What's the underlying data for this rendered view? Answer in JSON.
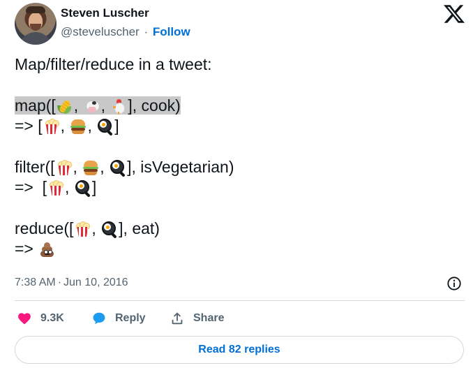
{
  "author": {
    "name": "Steven Luscher",
    "handle": "@steveluscher",
    "separator": "·",
    "follow_label": "Follow"
  },
  "tweet": {
    "intro": "Map/filter/reduce in a tweet:",
    "map": {
      "open": "map([",
      "sep1": ",",
      "sep2": ",",
      "close": "], cook)",
      "input_emojis": [
        "corn",
        "cow",
        "chicken"
      ],
      "arrow": "=> [",
      "out_sep1": ",",
      "out_sep2": ",",
      "out_close": "]",
      "output_emojis": [
        "popcorn",
        "hamburger",
        "fried-egg"
      ]
    },
    "filter": {
      "open": "filter([",
      "sep1": ",",
      "sep2": ",",
      "close": "], isVegetarian)",
      "input_emojis": [
        "popcorn",
        "hamburger",
        "fried-egg"
      ],
      "arrow": "=>  [",
      "out_sep1": ",",
      "out_close": "]",
      "output_emojis": [
        "popcorn",
        "fried-egg"
      ]
    },
    "reduce": {
      "open": "reduce([",
      "sep1": ",",
      "close": "], eat)",
      "input_emojis": [
        "popcorn",
        "fried-egg"
      ],
      "arrow": "=>",
      "output_emojis": [
        "pile-of-poo"
      ]
    }
  },
  "meta": {
    "time": "7:38 AM",
    "separator": "·",
    "date": "Jun 10, 2016"
  },
  "actions": {
    "like_count": "9.3K",
    "reply_label": "Reply",
    "share_label": "Share",
    "read_replies_label": "Read 82 replies"
  },
  "colors": {
    "text": "#0f1419",
    "secondary": "#536471",
    "link": "#006fd6",
    "like": "#f91880",
    "reply": "#1d9bf0",
    "highlight": "#c8c8c8",
    "border": "#cfd9de"
  }
}
